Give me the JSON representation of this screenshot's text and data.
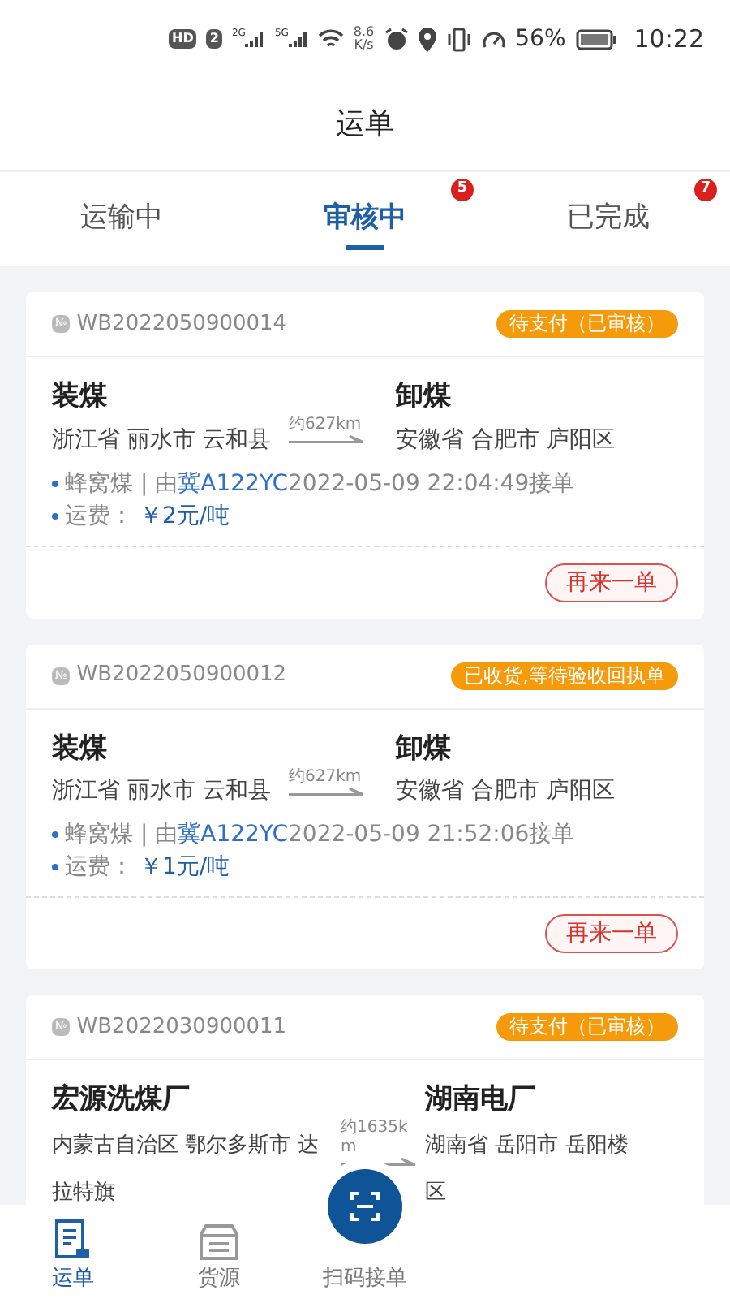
{
  "status_bar": {
    "hd": "HD",
    "sim": "2",
    "net1": "2G",
    "net2": "5G",
    "speed": "8.6",
    "speed_unit": "K/s",
    "battery": "56%",
    "time": "10:22"
  },
  "title": "运单",
  "tabs": [
    {
      "label": "运输中",
      "selected": false
    },
    {
      "label": "审核中",
      "selected": true,
      "badge": "5"
    },
    {
      "label": "已完成",
      "selected": false,
      "badge": "7"
    }
  ],
  "orders": [
    {
      "no_mark": "№",
      "order_no": "WB2022050900014",
      "status": "待支付（已审核）",
      "from": {
        "name": "装煤",
        "address": "浙江省 丽水市 云和县"
      },
      "distance": "约627km",
      "to": {
        "name": "卸煤",
        "address": "安徽省 合肥市 庐阳区"
      },
      "cargo": "蜂窝煤 | 由",
      "plate": "冀A122YC",
      "accepted": "2022-05-09 22:04:49接单",
      "fee_label": "运费：",
      "fee": "￥2元/吨",
      "action": "再来一单"
    },
    {
      "no_mark": "№",
      "order_no": "WB2022050900012",
      "status": "已收货,等待验收回执单",
      "from": {
        "name": "装煤",
        "address": "浙江省 丽水市 云和县"
      },
      "distance": "约627km",
      "to": {
        "name": "卸煤",
        "address": "安徽省 合肥市 庐阳区"
      },
      "cargo": "蜂窝煤 | 由",
      "plate": "冀A122YC",
      "accepted": "2022-05-09 21:52:06接单",
      "fee_label": "运费：",
      "fee": "￥1元/吨",
      "action": "再来一单"
    },
    {
      "no_mark": "№",
      "order_no": "WB2022030900011",
      "status": "待支付（已审核）",
      "from": {
        "name": "宏源洗煤厂",
        "address": "内蒙古自治区 鄂尔多斯市 达拉特旗"
      },
      "distance": "约1635km",
      "to": {
        "name": "湖南电厂",
        "address": "湖南省 岳阳市 岳阳楼区"
      }
    }
  ],
  "bottom_nav": [
    {
      "label": "运单",
      "selected": true,
      "kind": "waybill"
    },
    {
      "label": "货源",
      "selected": false,
      "kind": "cargo"
    },
    {
      "label": "扫码接单",
      "selected": false,
      "kind": "scan"
    }
  ]
}
